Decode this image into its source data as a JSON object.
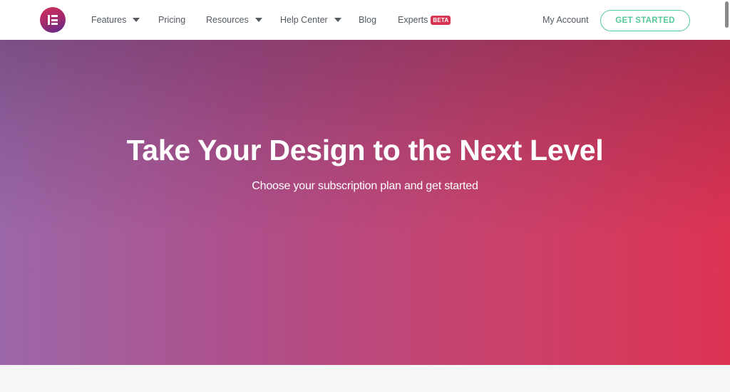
{
  "header": {
    "logo_icon": "elementor-logo-icon",
    "nav": [
      {
        "label": "Features",
        "has_dropdown": true
      },
      {
        "label": "Pricing",
        "has_dropdown": false
      },
      {
        "label": "Resources",
        "has_dropdown": true
      },
      {
        "label": "Help Center",
        "has_dropdown": true
      },
      {
        "label": "Blog",
        "has_dropdown": false
      },
      {
        "label": "Experts",
        "has_dropdown": false,
        "badge": "BETA"
      }
    ],
    "account_label": "My Account",
    "cta_label": "GET STARTED"
  },
  "hero": {
    "title": "Take Your Design to the Next Level",
    "subtitle": "Choose your subscription plan and get started"
  },
  "colors": {
    "cta_green": "#55c89a",
    "badge_red": "#d73554",
    "gradient_start": "#9b67a8",
    "gradient_end": "#dc3352",
    "nav_text": "#545a60"
  }
}
